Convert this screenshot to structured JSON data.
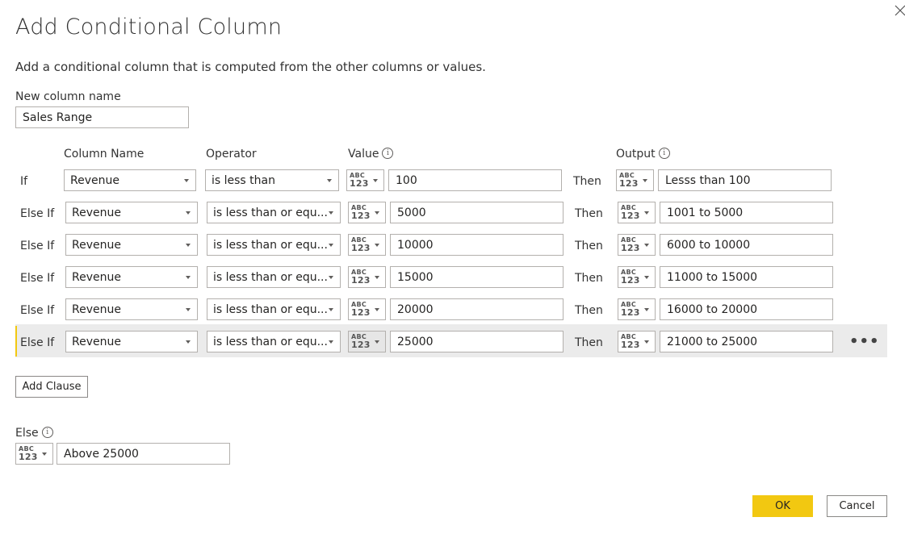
{
  "dialog": {
    "title": "Add Conditional Column",
    "subtitle": "Add a conditional column that is computed from the other columns or values.",
    "new_column_label": "New column name",
    "new_column_value": "Sales Range"
  },
  "headers": {
    "column_name": "Column Name",
    "operator": "Operator",
    "value": "Value",
    "output": "Output"
  },
  "type_icon": {
    "top": "ABC",
    "bottom": "123"
  },
  "clauses": [
    {
      "keyword": "If",
      "column": "Revenue",
      "operator": "is less than",
      "value": "100",
      "then": "Then",
      "output": "Lesss than 100"
    },
    {
      "keyword": "Else If",
      "column": "Revenue",
      "operator": "is less than or equ...",
      "value": "5000",
      "then": "Then",
      "output": "1001 to 5000"
    },
    {
      "keyword": "Else If",
      "column": "Revenue",
      "operator": "is less than or equ...",
      "value": "10000",
      "then": "Then",
      "output": "6000 to 10000"
    },
    {
      "keyword": "Else If",
      "column": "Revenue",
      "operator": "is less than or equ...",
      "value": "15000",
      "then": "Then",
      "output": "11000 to 15000"
    },
    {
      "keyword": "Else If",
      "column": "Revenue",
      "operator": "is less than or equ...",
      "value": "20000",
      "then": "Then",
      "output": "16000 to 20000"
    },
    {
      "keyword": "Else If",
      "column": "Revenue",
      "operator": "is less than or equ...",
      "value": "25000",
      "then": "Then",
      "output": "21000 to 25000"
    }
  ],
  "more_glyph": "•••",
  "add_clause_label": "Add Clause",
  "else_label": "Else",
  "else_value": "Above 25000",
  "info_glyph": "i",
  "buttons": {
    "ok": "OK",
    "cancel": "Cancel"
  },
  "colors": {
    "accent": "#f2c811",
    "border": "#b3b0ad",
    "selected_row": "#ebebeb"
  }
}
